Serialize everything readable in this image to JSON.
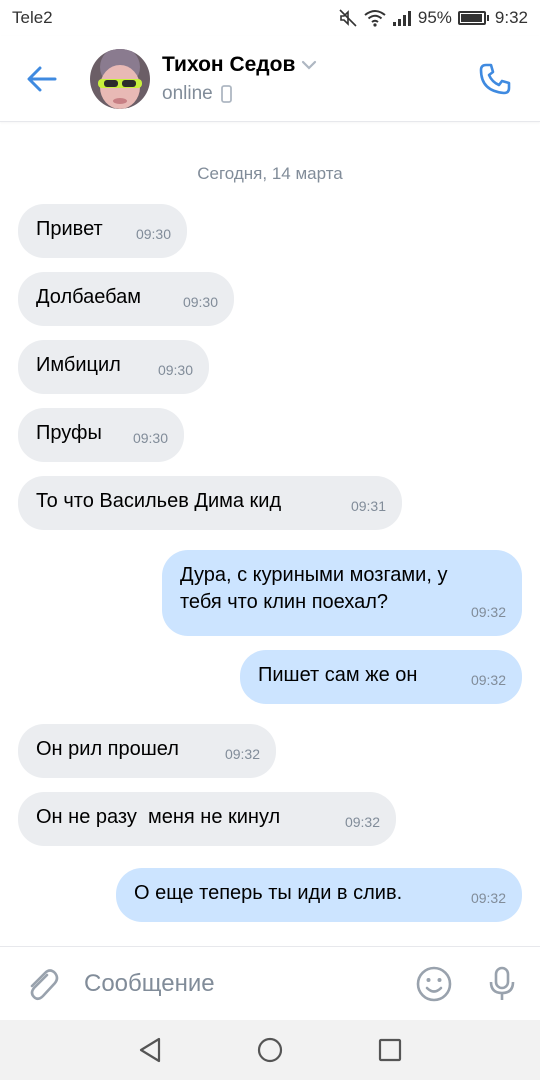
{
  "status_bar": {
    "carrier": "Tele2",
    "battery_percent": "95%",
    "battery_level": 0.95,
    "time": "9:32",
    "icons": [
      "mute-icon",
      "wifi-icon",
      "signal-icon",
      "battery-icon"
    ]
  },
  "header": {
    "name": "Тихон Седов",
    "status": "online",
    "icons": [
      "back-arrow-icon",
      "chevron-down-icon",
      "mobile-icon",
      "phone-icon"
    ]
  },
  "chat": {
    "date_separator": "Сегодня, 14 марта",
    "messages": [
      {
        "direction": "in",
        "text": "Привет",
        "time": "09:30"
      },
      {
        "direction": "in",
        "text": "Долбаебам",
        "time": "09:30"
      },
      {
        "direction": "in",
        "text": "Имбицил",
        "time": "09:30"
      },
      {
        "direction": "in",
        "text": "Пруфы",
        "time": "09:30"
      },
      {
        "direction": "in",
        "text": "То что Васильев Дима кид",
        "time": "09:31"
      },
      {
        "direction": "out",
        "text": "Дура, с куриными мозгами, у\nтебя что клин поехал?",
        "time": "09:32"
      },
      {
        "direction": "out",
        "text": "Пишет сам же он",
        "time": "09:32"
      },
      {
        "direction": "in",
        "text": "Он рил прошел",
        "time": "09:32"
      },
      {
        "direction": "in",
        "text": "Он не разу  меня не кинул",
        "time": "09:32"
      },
      {
        "direction": "out",
        "text": "О еще теперь ты иди в слив.",
        "time": "09:32"
      }
    ]
  },
  "composer": {
    "placeholder": "Сообщение",
    "icons": [
      "paperclip-icon",
      "emoji-icon",
      "microphone-icon"
    ]
  },
  "colors": {
    "accent": "#3f8ae0",
    "incoming_bubble": "#ebedf0",
    "outgoing_bubble": "#cce4ff",
    "secondary_text": "#818c99"
  }
}
